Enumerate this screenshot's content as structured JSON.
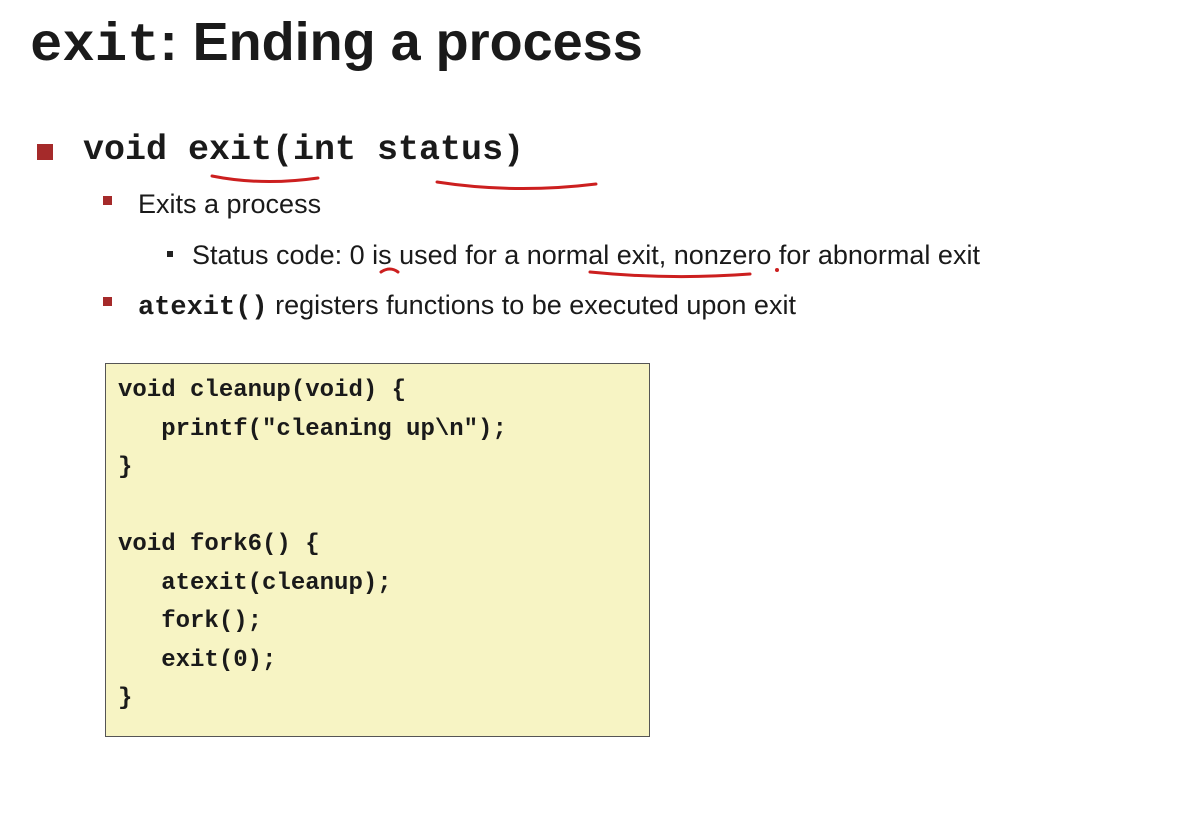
{
  "title": {
    "code": "exit",
    "text": ": Ending a process"
  },
  "bullets": {
    "signature": "void exit(int status)",
    "exits": "Exits a process",
    "status_pre": "Status code: ",
    "status_zero": "0",
    "status_mid": " is used for a ",
    "status_normal": "normal exit",
    "status_post": ", nonzero for abnormal exit",
    "atexit_code": "atexit()",
    "atexit_text": " registers functions to be executed upon exit"
  },
  "code": {
    "lines": [
      "void cleanup(void) {",
      "   printf(\"cleaning up\\n\");",
      "}",
      "",
      "void fork6() {",
      "   atexit(cleanup);",
      "   fork();",
      "   exit(0);",
      "}"
    ]
  },
  "colors": {
    "bullet": "#a52a2a",
    "annotation": "#cc1f1f",
    "code_background": "#f7f4c4"
  }
}
